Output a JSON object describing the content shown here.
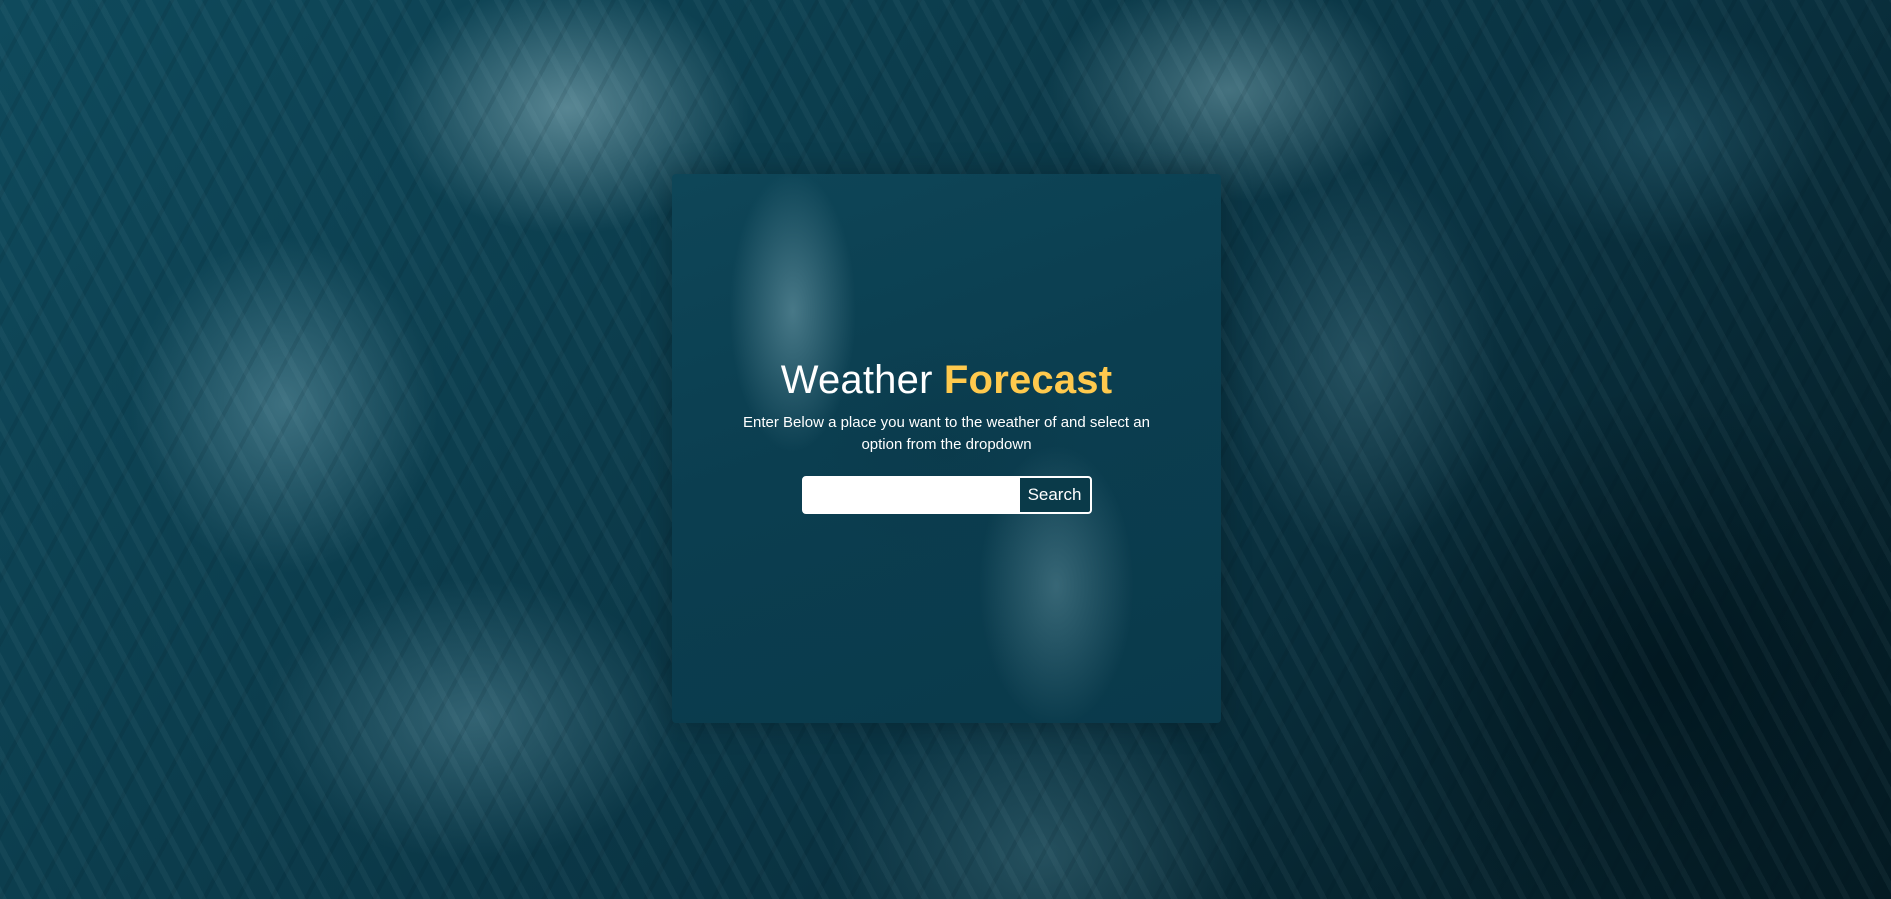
{
  "app": {
    "title_main": "Weather",
    "title_accent": "Forecast",
    "instructions": "Enter Below a place you want to the weather of and select an option from the dropdown"
  },
  "search": {
    "value": "",
    "placeholder": "",
    "button_label": "Search"
  },
  "colors": {
    "accent": "#ffc94d",
    "button_bg": "#0a3a49",
    "text": "#ffffff"
  }
}
